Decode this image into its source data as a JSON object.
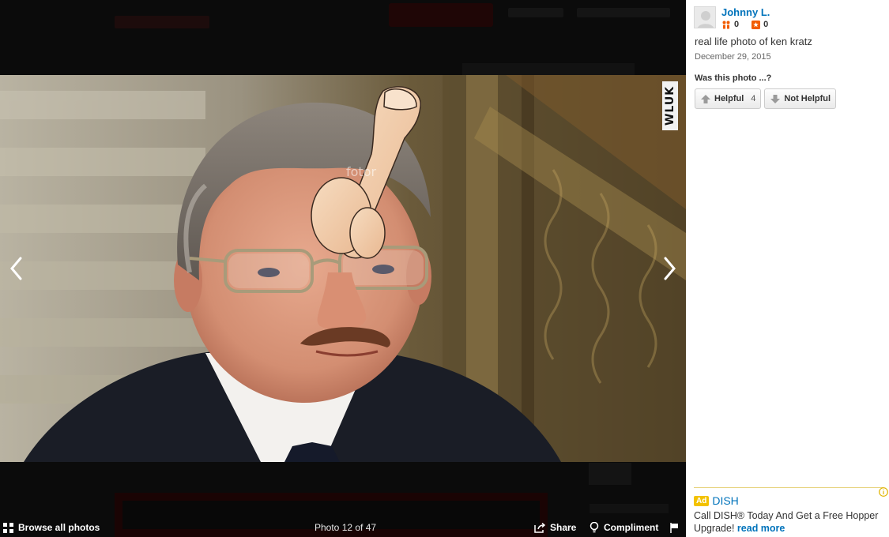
{
  "photo": {
    "watermark": "WLUK"
  },
  "toolbar": {
    "browse_label": "Browse all photos",
    "photo_count": "Photo 12 of 47",
    "share_label": "Share",
    "compliment_label": "Compliment"
  },
  "sidebar": {
    "user": {
      "name": "Johnny L.",
      "friends_count": "0",
      "reviews_count": "0"
    },
    "caption": "real life photo of ken kratz",
    "date": "December 29, 2015",
    "question": "Was this photo ...?",
    "helpful_label": "Helpful",
    "helpful_count": "4",
    "not_helpful_label": "Not Helpful"
  },
  "ad": {
    "badge": "Ad",
    "brand": "DISH",
    "text": "Call DISH® Today And Get a Free Hopper Upgrade!",
    "more_label": "read more"
  },
  "colors": {
    "link_blue": "#0073bb",
    "ad_badge": "#f3c200",
    "friends_icon": "#f15c00",
    "reviews_icon": "#f15c00"
  }
}
